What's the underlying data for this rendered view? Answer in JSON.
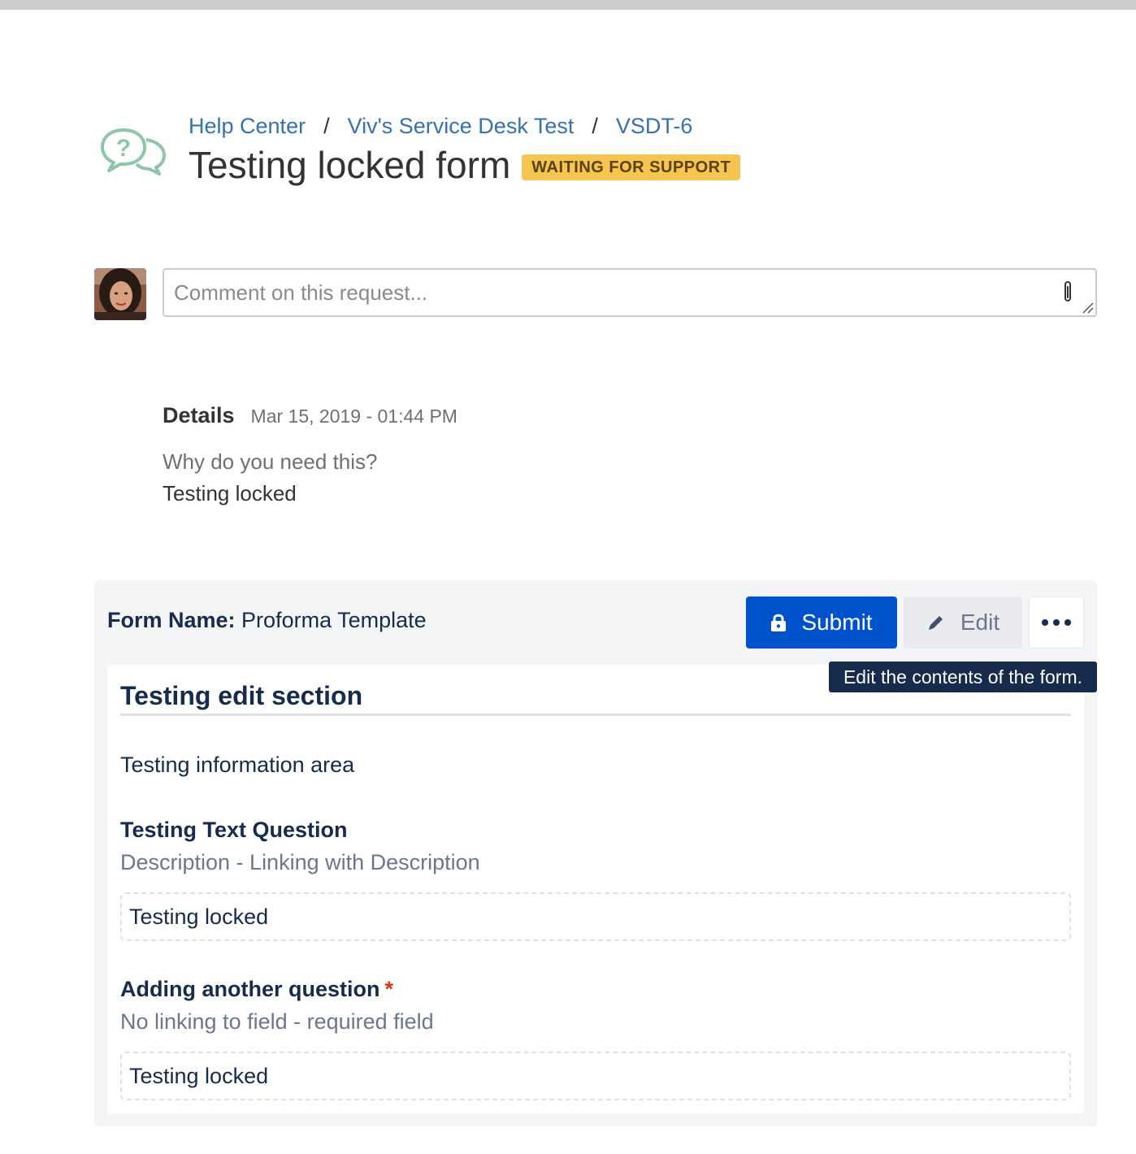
{
  "breadcrumb": {
    "items": [
      "Help Center",
      "Viv's Service Desk Test",
      "VSDT-6"
    ],
    "separator": "/"
  },
  "request": {
    "title": "Testing locked form",
    "status": "WAITING FOR SUPPORT"
  },
  "comment": {
    "placeholder": "Comment on this request..."
  },
  "details": {
    "label": "Details",
    "date": "Mar 15, 2019 - 01:44 PM",
    "question": "Why do you need this?",
    "answer": "Testing locked"
  },
  "form": {
    "name_label": "Form Name:",
    "name_value": "Proforma Template",
    "submit_label": "Submit",
    "edit_label": "Edit",
    "tooltip": "Edit the contents of the form.",
    "section_title": "Testing edit section",
    "info_text": "Testing information area",
    "questions": [
      {
        "label": "Testing Text Question",
        "description": "Description - Linking with Description",
        "answer": "Testing locked",
        "required": false
      },
      {
        "label": "Adding another question",
        "description": "No linking to field - required field",
        "answer": "Testing locked",
        "required": true,
        "required_marker": "*"
      }
    ]
  },
  "colors": {
    "link": "#3572b0",
    "status_badge": "#f5c451",
    "primary_button": "#0052cc",
    "tooltip_bg": "#172b4d",
    "required": "#de350b"
  },
  "icons": {
    "help": "help-center-chat-icon",
    "attach": "paperclip-icon",
    "lock": "lock-icon",
    "edit": "pencil-icon",
    "more": "more-dots-icon"
  }
}
